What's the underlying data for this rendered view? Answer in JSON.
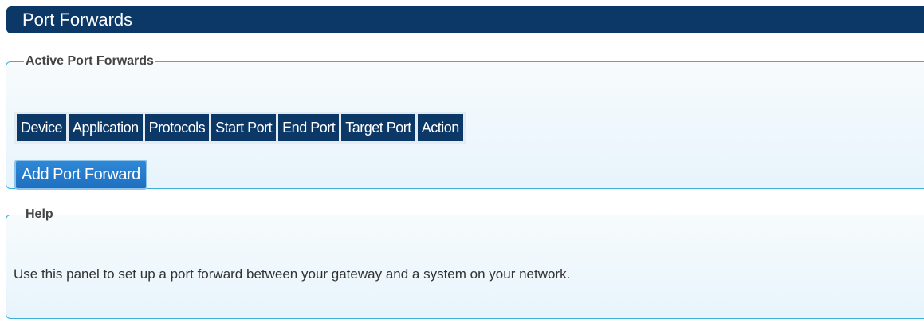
{
  "page": {
    "title": "Port Forwards"
  },
  "active_panel": {
    "legend": "Active Port Forwards",
    "columns": [
      "Device",
      "Application",
      "Protocols",
      "Start Port",
      "End Port",
      "Target Port",
      "Action"
    ],
    "add_button_label": "Add Port Forward"
  },
  "help_panel": {
    "legend": "Help",
    "text": "Use this panel to set up a port forward between your gateway and a system on your network."
  },
  "colors": {
    "header_bg": "#0b3866",
    "panel_border": "#3ab0d8",
    "button_bg": "#1e6fbf"
  }
}
